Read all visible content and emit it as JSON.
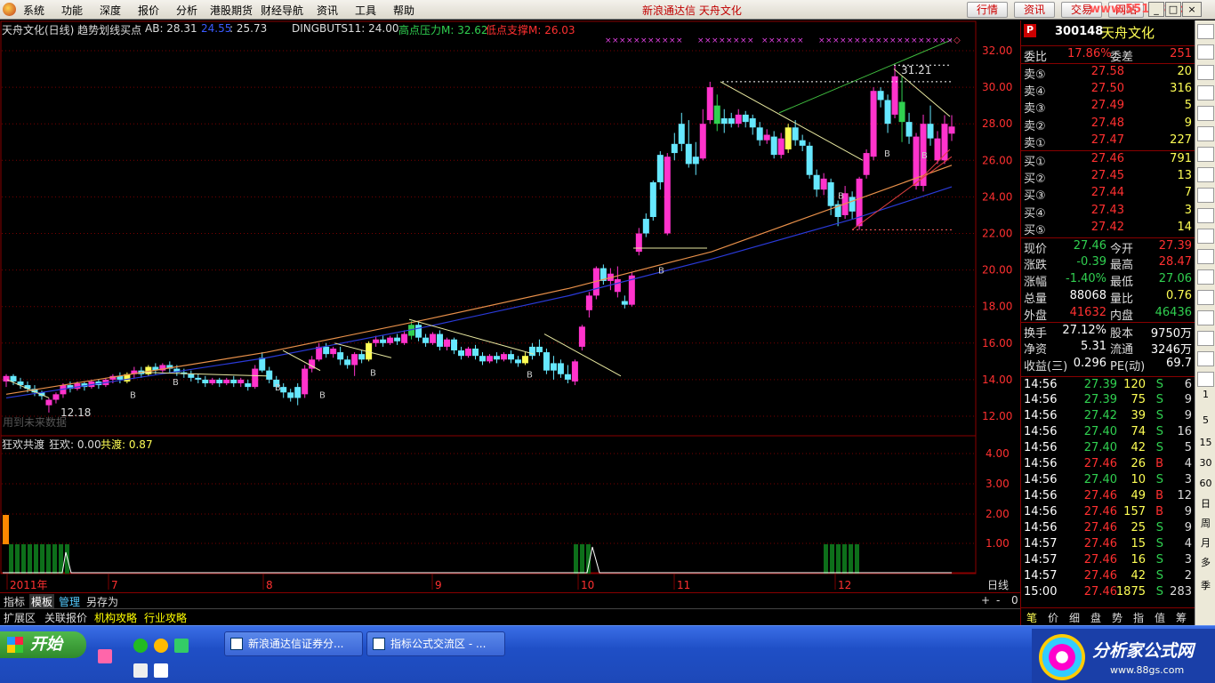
{
  "menu": {
    "items": [
      "系统",
      "功能",
      "深度",
      "报价",
      "分析",
      "港股期货",
      "财经导航",
      "资讯",
      "工具",
      "帮助"
    ],
    "app_title": "新浪通达信 天舟文化",
    "tb_buttons": [
      "行情",
      "资讯",
      "交易",
      "网站"
    ],
    "watermark": "www.55188.com",
    "win_buttons": [
      "_",
      "□",
      "×"
    ]
  },
  "main_header": {
    "title": "天舟文化(日线) 趋势划线买点",
    "ab_label": "AB: 28.31",
    "v2": "24.55",
    "v3": ": 25.73",
    "dingbuts": "DINGBUTS11: 24.00",
    "high_label": "高点压力M: 32.62",
    "low_label": "低点支撑M: 26.03"
  },
  "main_annot": {
    "low_price": "12.18",
    "high_price": "31.21",
    "faded_text": "用到未来数据"
  },
  "sub_header": {
    "name": "狂欢共渡",
    "kh": "狂欢: 0.00",
    "gd": "共渡: 0.87"
  },
  "price_axis": [
    "32.00",
    "30.00",
    "28.00",
    "26.00",
    "24.00",
    "22.00",
    "20.00",
    "18.00",
    "16.00",
    "14.00",
    "12.00"
  ],
  "sub_axis": [
    "4.00",
    "3.00",
    "2.00",
    "1.00"
  ],
  "time_axis": {
    "labels": [
      "2011年",
      "7",
      "8",
      "9",
      "10",
      "11",
      "12"
    ],
    "period": "日线",
    "ctrls": [
      "+",
      "-",
      "0"
    ]
  },
  "bottom_tabs": [
    "指标",
    "模板",
    "管理",
    "另存为"
  ],
  "sub_tabs": [
    "扩展区",
    "关联报价",
    "机构攻略",
    "行业攻略"
  ],
  "quote": {
    "code": "300148",
    "name": "天舟文化",
    "weibi_label": "委比",
    "weibi": "17.86%",
    "weicha_label": "委差",
    "weicha": "251",
    "sells": [
      {
        "label": "卖⑤",
        "price": "27.58",
        "vol": "20"
      },
      {
        "label": "卖④",
        "price": "27.50",
        "vol": "316"
      },
      {
        "label": "卖③",
        "price": "27.49",
        "vol": "5"
      },
      {
        "label": "卖②",
        "price": "27.48",
        "vol": "9"
      },
      {
        "label": "卖①",
        "price": "27.47",
        "vol": "227"
      }
    ],
    "buys": [
      {
        "label": "买①",
        "price": "27.46",
        "vol": "791"
      },
      {
        "label": "买②",
        "price": "27.45",
        "vol": "13"
      },
      {
        "label": "买③",
        "price": "27.44",
        "vol": "7"
      },
      {
        "label": "买④",
        "price": "27.43",
        "vol": "3"
      },
      {
        "label": "买⑤",
        "price": "27.42",
        "vol": "14"
      }
    ],
    "stats": [
      [
        "现价",
        "27.46",
        "今开",
        "27.39"
      ],
      [
        "涨跌",
        "-0.39",
        "最高",
        "28.47"
      ],
      [
        "涨幅",
        "-1.40%",
        "最低",
        "27.06"
      ],
      [
        "总量",
        "88068",
        "量比",
        "0.76"
      ],
      [
        "外盘",
        "41632",
        "内盘",
        "46436"
      ],
      [
        "换手",
        "27.12%",
        "股本",
        "9750万"
      ],
      [
        "净资",
        "5.31",
        "流通",
        "3246万"
      ],
      [
        "收益(三)",
        "0.296",
        "PE(动)",
        "69.7"
      ]
    ],
    "ticks": [
      [
        "14:56",
        "27.39",
        "120",
        "S",
        "6"
      ],
      [
        "14:56",
        "27.39",
        "75",
        "S",
        "9"
      ],
      [
        "14:56",
        "27.42",
        "39",
        "S",
        "9"
      ],
      [
        "14:56",
        "27.40",
        "74",
        "S",
        "16"
      ],
      [
        "14:56",
        "27.40",
        "42",
        "S",
        "5"
      ],
      [
        "14:56",
        "27.46",
        "26",
        "B",
        "4"
      ],
      [
        "14:56",
        "27.40",
        "10",
        "S",
        "3"
      ],
      [
        "14:56",
        "27.46",
        "49",
        "B",
        "12"
      ],
      [
        "14:56",
        "27.46",
        "157",
        "B",
        "9"
      ],
      [
        "14:56",
        "27.46",
        "25",
        "S",
        "9"
      ],
      [
        "14:57",
        "27.46",
        "15",
        "S",
        "4"
      ],
      [
        "14:57",
        "27.46",
        "16",
        "S",
        "3"
      ],
      [
        "14:57",
        "27.46",
        "42",
        "S",
        "2"
      ],
      [
        "15:00",
        "27.46",
        "1875",
        "S",
        "283"
      ]
    ],
    "bottom_tabs": [
      "笔",
      "价",
      "细",
      "盘",
      "势",
      "指",
      "值",
      "筹"
    ]
  },
  "toolbar": {
    "icons": [
      "RSI"
    ],
    "nums": [
      "1",
      "5",
      "15",
      "30",
      "60",
      "日",
      "周",
      "月",
      "多",
      "季"
    ]
  },
  "taskbar": {
    "start": "开始",
    "items": [
      "新浪通达信证券分...",
      "指标公式交流区 - ..."
    ]
  },
  "brand": {
    "name": "分析家公式网",
    "url": "www.88gs.com"
  },
  "colors": {
    "up": "#ff33cc",
    "down": "#66e8ff",
    "red": "#ff3030",
    "green": "#30d050",
    "yellow": "#ffff55",
    "grid": "#7a0000"
  }
}
